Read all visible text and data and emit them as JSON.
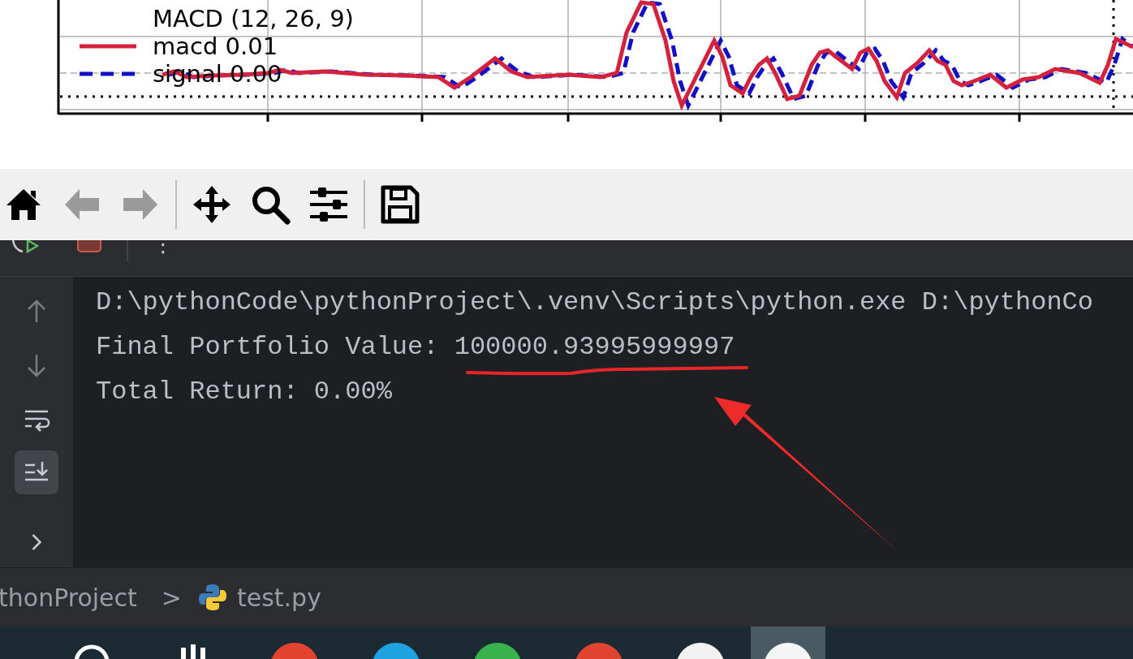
{
  "chart": {
    "legend_title": "MACD (12, 26, 9)",
    "legend": [
      {
        "kind": "solid",
        "color": "#d4213d",
        "label": "macd 0.01"
      },
      {
        "kind": "dashed",
        "color": "#1010c8",
        "label": "signal 0.00"
      }
    ]
  },
  "plot_toolbar": {
    "buttons": [
      {
        "kind": "home",
        "disabled": false
      },
      {
        "kind": "back",
        "disabled": true
      },
      {
        "kind": "forward",
        "disabled": true
      },
      {
        "kind": "sep"
      },
      {
        "kind": "pan",
        "disabled": false
      },
      {
        "kind": "zoom",
        "disabled": false
      },
      {
        "kind": "configure",
        "disabled": false
      },
      {
        "kind": "sep"
      },
      {
        "kind": "save",
        "disabled": false
      }
    ]
  },
  "run_toolbar": {
    "more": "⋮"
  },
  "gutter": [
    {
      "kind": "up",
      "disabled": true,
      "selected": false
    },
    {
      "kind": "down",
      "disabled": true,
      "selected": false
    },
    {
      "kind": "wrap",
      "disabled": false,
      "selected": false
    },
    {
      "kind": "scroll-end",
      "disabled": false,
      "selected": true
    },
    {
      "kind": "chevron",
      "disabled": false,
      "selected": false
    }
  ],
  "console": {
    "lines": [
      {
        "text": "D:\\pythonCode\\pythonProject\\.venv\\Scripts\\python.exe D:\\pythonCo"
      },
      {
        "text": "Final Portfolio Value: ",
        "value": "100000.93995999997"
      },
      {
        "text": "Total Return: 0.00%"
      }
    ]
  },
  "breadcrumb": {
    "project": "thonProject",
    "separator": ">",
    "file": "test.py"
  },
  "taskbar": {
    "apps": [
      {
        "kind": "search",
        "selected": false
      },
      {
        "kind": "widgets",
        "selected": false
      },
      {
        "kind": "app",
        "color": "#e2442f",
        "selected": false
      },
      {
        "kind": "app",
        "color": "#1fa2e0",
        "selected": false
      },
      {
        "kind": "app",
        "color": "#37b24d",
        "selected": false
      },
      {
        "kind": "app",
        "color": "#e0432f",
        "selected": false
      },
      {
        "kind": "app",
        "color": "#f2f2f2",
        "selected": false
      },
      {
        "kind": "app",
        "color": "#f5f5f5",
        "selected": true
      }
    ]
  }
}
